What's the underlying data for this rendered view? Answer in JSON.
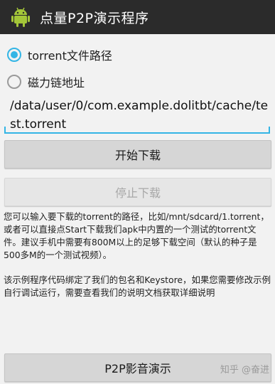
{
  "app_bar": {
    "title": "点量P2P演示程序",
    "icon": "android-robot-icon",
    "background": "#2b2b2b"
  },
  "source_options": [
    {
      "label": "torrent文件路径",
      "checked": true
    },
    {
      "label": "磁力链地址",
      "checked": false
    }
  ],
  "path_input": {
    "value": "/data/user/0/com.example.dolitbt/cache/test.torrent"
  },
  "buttons": {
    "start": "开始下载",
    "stop": "停止下载",
    "media_demo": "P2P影音演示"
  },
  "description": {
    "paragraph1": "您可以输入要下载的torrent的路径，比如/mnt/sdcard/1.torrent，或者可以直接点Start下载我们apk中内置的一个测试的torrent文件。建议手机中需要有800M以上的足够下载空间（默认的种子是500多M的一个测试视频）。",
    "paragraph2": "该示例程序代码绑定了我们的包名和Keystore，如果您需要修改示例自行调试运行，需要查看我们的说明文档获取详细说明"
  },
  "watermark": "知乎 @奋进",
  "colors": {
    "accent": "#33b5e5",
    "background": "#f2f2f2",
    "button": "#d6d6d6"
  }
}
